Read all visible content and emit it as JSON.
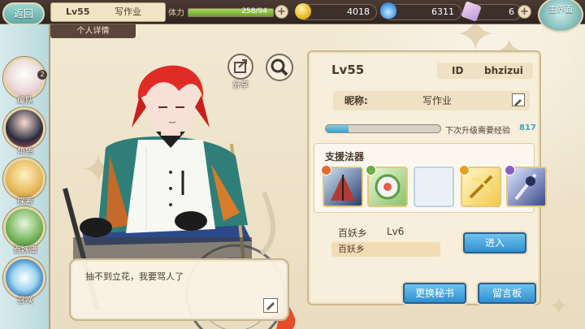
{
  "topbar": {
    "back_label": "返回",
    "player": {
      "level": "Lv55",
      "name": "写作业"
    },
    "detail_tab": "个人详情",
    "stamina": {
      "label": "体力",
      "value": "258/94",
      "fill_fraction": 1.0
    },
    "gold": "4018",
    "gem": "6311",
    "ticket": "6",
    "home_label": "主界面"
  },
  "sidebar": {
    "items": [
      {
        "label": "编队",
        "badge": "2",
        "icon": "team-icon"
      },
      {
        "label": "角色",
        "icon": "character-icon"
      },
      {
        "label": "探索",
        "icon": "explore-icon"
      },
      {
        "label": "百妖谱",
        "icon": "yokai-book-icon"
      },
      {
        "label": "召唤",
        "icon": "summon-icon"
      }
    ]
  },
  "share_label": "分享",
  "dialogue": {
    "text": "抽不到立花，我要骂人了"
  },
  "profile": {
    "level": "Lv55",
    "id_label": "ID",
    "id_value": "bhzizui",
    "nickname_label": "昵称:",
    "nickname_value": "写作业",
    "exp": {
      "fill_fraction": 0.2,
      "label": "下次升级需要经验",
      "value": "817"
    },
    "support": {
      "title": "支援法器",
      "slots": [
        {
          "state": "filled",
          "icon": "fan-weapon-icon",
          "rank_color": "#e36a2a"
        },
        {
          "state": "filled",
          "icon": "green-orb-icon",
          "rank_color": "#6cab3f"
        },
        {
          "state": "empty"
        },
        {
          "state": "filled",
          "icon": "golden-bow-icon",
          "rank_color": "#e6a21d"
        },
        {
          "state": "filled",
          "icon": "dark-blade-icon",
          "rank_color": "#8a60c7"
        }
      ]
    },
    "pet": {
      "name": "百妖乡",
      "level": "Lv6",
      "chip": "百妖乡"
    },
    "enter_button": "进入",
    "change_secretary_button": "更换秘书",
    "message_board_button": "留言板"
  },
  "colors": {
    "accent_teal": "#6fb3b0",
    "button_blue": "#2f8fd0",
    "exp_blue": "#3aa1c7"
  }
}
